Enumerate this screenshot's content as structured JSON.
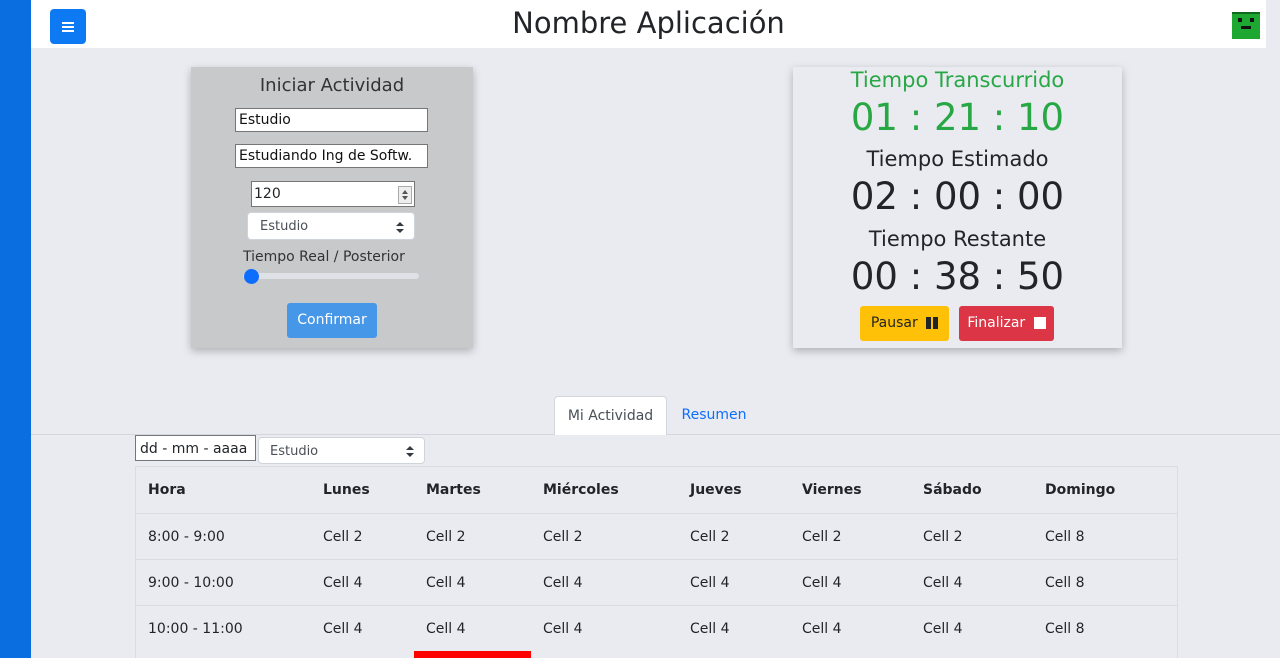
{
  "header": {
    "title": "Nombre Aplicación"
  },
  "start_panel": {
    "title": "Iniciar Actividad",
    "activity_value": "Estudio",
    "description_value": "Estudiando Ing de Softw.",
    "minutes_value": "120",
    "category_selected": "Estudio",
    "slider_label": "Tiempo Real / Posterior",
    "slider_level": 0,
    "confirm_label": "Confirmar"
  },
  "timer_panel": {
    "elapsed_label": "Tiempo Transcurrido",
    "elapsed_value": "01 : 21 : 10",
    "estimated_label": "Tiempo Estimado",
    "estimated_value": "02 : 00 : 00",
    "remaining_label": "Tiempo Restante",
    "remaining_value": "00 : 38 : 50",
    "pause_label": "Pausar",
    "finish_label": "Finalizar"
  },
  "tabs": [
    {
      "label": "Mi Actividad",
      "active": true
    },
    {
      "label": "Resumen",
      "active": false
    }
  ],
  "filters": {
    "date_placeholder": "dd - mm - aaaa",
    "category_selected": "Estudio"
  },
  "table": {
    "headers": [
      "Hora",
      "Lunes",
      "Martes",
      "Miércoles",
      "Jueves",
      "Viernes",
      "Sábado",
      "Domingo"
    ],
    "rows": [
      [
        "8:00 - 9:00",
        "Cell 2",
        "Cell 2",
        "Cell 2",
        "Cell 2",
        "Cell 2",
        "Cell 2",
        "Cell 8"
      ],
      [
        "9:00 - 10:00",
        "Cell 4",
        "Cell 4",
        "Cell 4",
        "Cell 4",
        "Cell 4",
        "Cell 4",
        "Cell 8"
      ],
      [
        "10:00 - 11:00",
        "Cell 4",
        "Cell 4",
        "Cell 4",
        "Cell 4",
        "Cell 4",
        "Cell 4",
        "Cell 8"
      ]
    ]
  },
  "colors": {
    "primary": "#0d79f2",
    "elapsed": "#28a745",
    "pause": "#ffc107",
    "finish": "#dc3545",
    "highlight": "#ff0000"
  },
  "icons": [
    "menu-icon",
    "avatar-icon",
    "spinner-icon",
    "chevron-updown-icon",
    "pause-icon",
    "stop-icon"
  ]
}
